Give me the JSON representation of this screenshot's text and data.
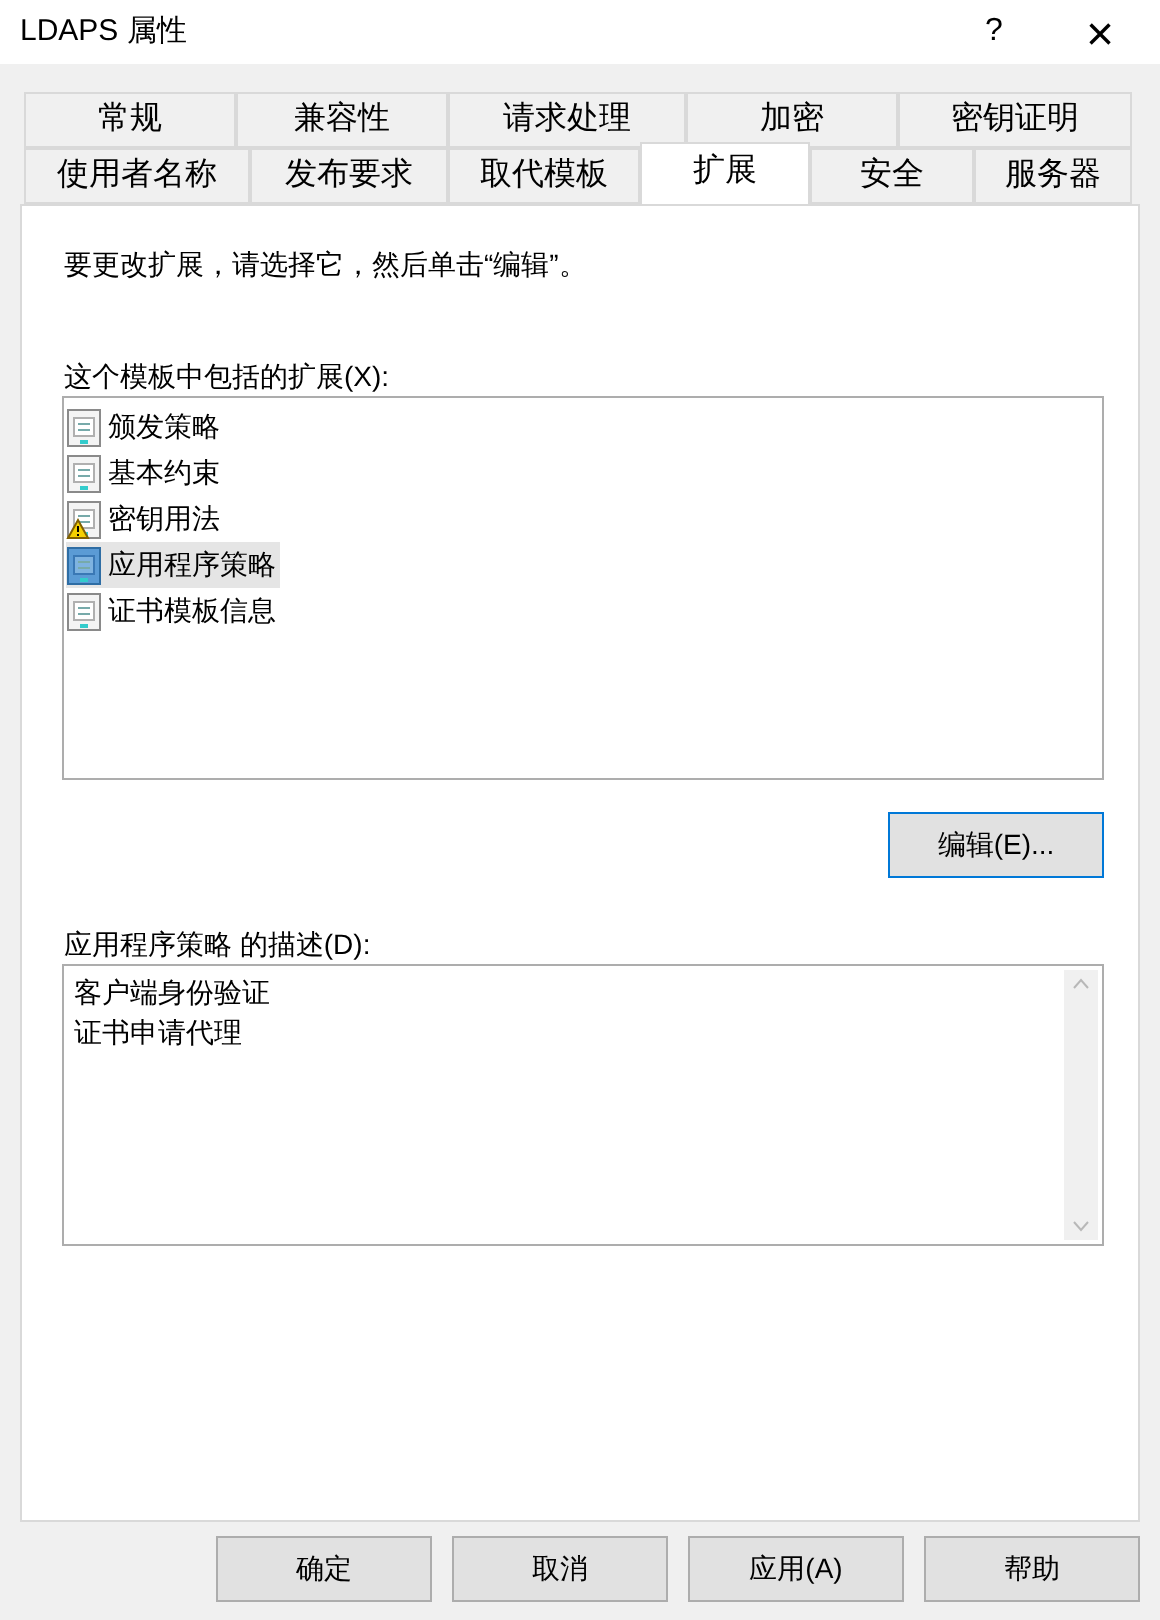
{
  "window": {
    "title": "LDAPS 属性",
    "help": "?",
    "close": "×"
  },
  "tab_rows": [
    [
      {
        "label": "常规",
        "selected": false
      },
      {
        "label": "兼容性",
        "selected": false
      },
      {
        "label": "请求处理",
        "selected": false
      },
      {
        "label": "加密",
        "selected": false
      },
      {
        "label": "密钥证明",
        "selected": false
      }
    ],
    [
      {
        "label": "使用者名称",
        "selected": false
      },
      {
        "label": "发布要求",
        "selected": false
      },
      {
        "label": "取代模板",
        "selected": false
      },
      {
        "label": "扩展",
        "selected": true
      },
      {
        "label": "安全",
        "selected": false
      },
      {
        "label": "服务器",
        "selected": false
      }
    ]
  ],
  "instruction": "要更改扩展，请选择它，然后单击“编辑”。",
  "extensions": {
    "label": "这个模板中包括的扩展(X):",
    "items": [
      {
        "name": "颁发策略",
        "warning": false,
        "selected": false
      },
      {
        "name": "基本约束",
        "warning": false,
        "selected": false
      },
      {
        "name": "密钥用法",
        "warning": true,
        "selected": false
      },
      {
        "name": "应用程序策略",
        "warning": false,
        "selected": true
      },
      {
        "name": "证书模板信息",
        "warning": false,
        "selected": false
      }
    ]
  },
  "edit_button": "编辑(E)...",
  "description": {
    "label": "应用程序策略 的描述(D):",
    "lines": [
      "客户端身份验证",
      "证书申请代理"
    ]
  },
  "buttons": [
    "确定",
    "取消",
    "应用(A)",
    "帮助"
  ]
}
